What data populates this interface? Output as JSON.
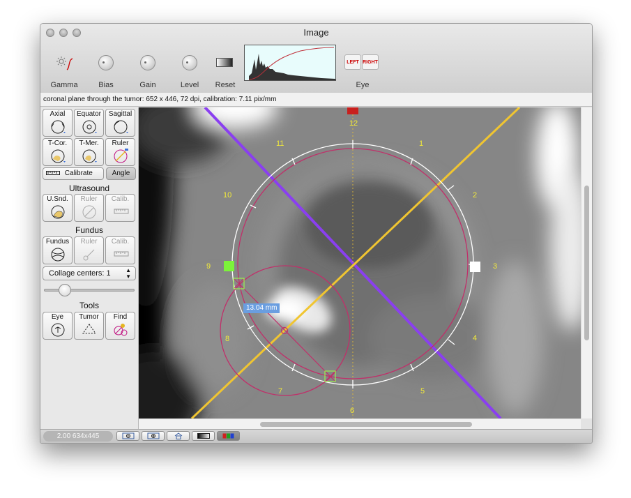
{
  "window": {
    "title": "Image"
  },
  "toolbar": {
    "gamma_label": "Gamma",
    "bias_label": "Bias",
    "gain_label": "Gain",
    "level_label": "Level",
    "reset_label": "Reset",
    "eye_label": "Eye",
    "eye_left": "LEFT",
    "eye_right": "RIGHT"
  },
  "info": {
    "text": "coronal plane through the tumor: 652 x 446, 72 dpi, calibration: 7.11 pix/mm"
  },
  "sidebar": {
    "axial": "Axial",
    "equator": "Equator",
    "sagittal": "Sagittal",
    "tcor": "T-Cor.",
    "tmer": "T-Mer.",
    "ruler": "Ruler",
    "calibrate": "Calibrate",
    "angle": "Angle",
    "ultrasound_header": "Ultrasound",
    "usnd": "U.Snd.",
    "us_ruler": "Ruler",
    "us_calib": "Calib.",
    "fundus_header": "Fundus",
    "fundus": "Fundus",
    "fundus_ruler": "Ruler",
    "fundus_calib": "Calib.",
    "collage": "Collage centers: 1",
    "tools_header": "Tools",
    "eye": "Eye",
    "tumor": "Tumor",
    "find": "Find"
  },
  "overlay": {
    "clock_labels": [
      "12",
      "1",
      "2",
      "3",
      "4",
      "5",
      "6",
      "7",
      "8",
      "9",
      "10",
      "11"
    ],
    "measurement": "13.04 mm"
  },
  "status": {
    "zoom_info": "2.00 634x445"
  },
  "colors": {
    "purple_line": "#8a3ff0",
    "yellow_line": "#f0c531",
    "circle_pink": "#c0306a",
    "label_yellow": "#f2ea3a"
  }
}
